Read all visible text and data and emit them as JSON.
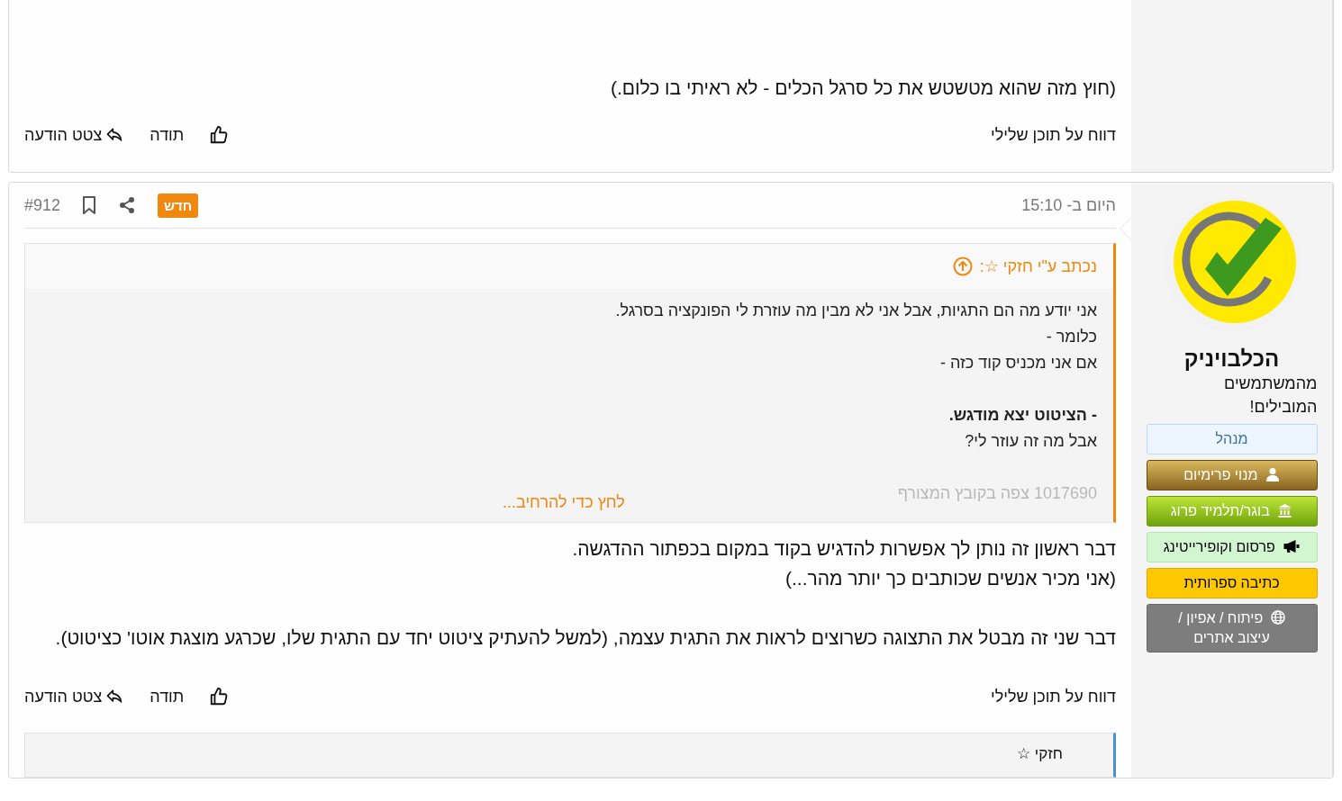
{
  "posts": [
    {
      "kind": "partial",
      "paragraphs": [
        "(חוץ מזה שהוא מטשטש את כל סרגל הכלים - לא ראיתי בו כלום.)"
      ],
      "actions": {
        "report": "דווח על תוכן שלילי",
        "thanks": "תודה",
        "quote": "צטט הודעה"
      }
    },
    {
      "kind": "full",
      "user": {
        "name": "הכלבויניק",
        "title": "מהמשתמשים המובילים!",
        "badges": [
          {
            "label": "מנהל",
            "kind": "admin"
          },
          {
            "label": "מנוי פרימיום",
            "kind": "premium"
          },
          {
            "label": "בוגר/תלמיד פרוג",
            "kind": "graduate"
          },
          {
            "label": "פרסום וקופירייטינג",
            "kind": "marketing"
          },
          {
            "label": "כתיבה ספרותית",
            "kind": "writing"
          },
          {
            "label": "פיתוח / אפיון / עיצוב אתרים",
            "kind": "web"
          }
        ]
      },
      "date": "היום ב- 15:10",
      "new_badge": "חדש",
      "number": "#912",
      "quote": {
        "author": "נכתב ע\"י חזקי ☆:",
        "lines": [
          {
            "text": "אני יודע מה הם התגיות, אבל אני לא מבין מה עוזרת לי הפונקציה בסרגל.",
            "kind": "normal"
          },
          {
            "text": "כלומר -",
            "kind": "normal"
          },
          {
            "text": "אם אני מכניס קוד כזה -",
            "kind": "normal"
          },
          {
            "kind": "blank"
          },
          {
            "text": "- הציטוט יצא מודגש.",
            "kind": "bold"
          },
          {
            "text": "אבל מה זה עוזר לי?",
            "kind": "normal"
          },
          {
            "kind": "blank"
          },
          {
            "text": "1017690 צפה בקובץ המצורף",
            "kind": "faded"
          }
        ],
        "expand": "לחץ כדי להרחיב..."
      },
      "paragraphs": [
        "דבר ראשון זה נותן לך אפשרות להדגיש בקוד במקום בכפתור ההדגשה.\n(אני מכיר אנשים שכותבים כך יותר מהר...)",
        "דבר שני זה מבטל את התצוגה כשרוצים לראות את התגית עצמה, (למשל להעתיק ציטוט יחד עם התגית שלו, שכרגע מוצגת אוטו' כציטוט)."
      ],
      "actions": {
        "report": "דווח על תוכן שלילי",
        "thanks": "תודה",
        "quote": "צטט הודעה"
      },
      "next_quote": {
        "author": "חזקי ☆"
      }
    }
  ]
}
